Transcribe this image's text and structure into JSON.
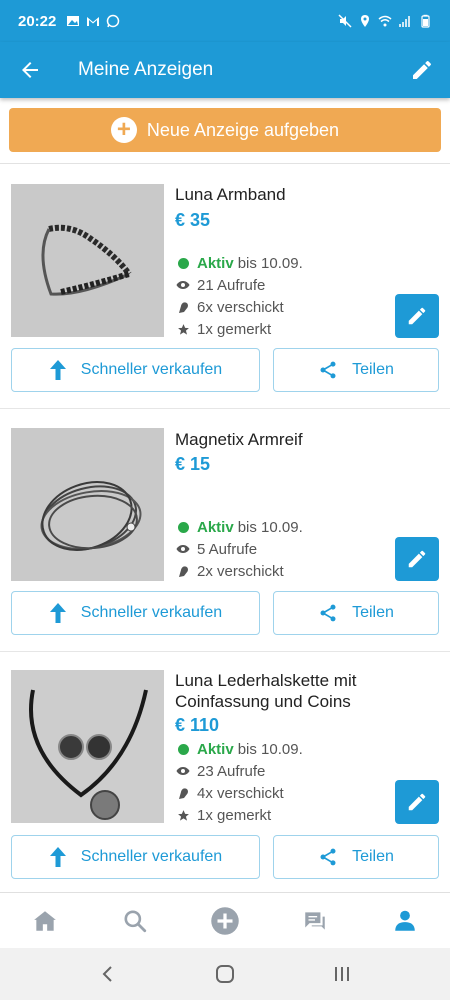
{
  "statusbar": {
    "time": "20:22"
  },
  "appbar": {
    "title": "Meine Anzeigen"
  },
  "new_ad": {
    "label": "Neue Anzeige aufgeben"
  },
  "listings": [
    {
      "title": "Luna Armband",
      "price": "€ 35",
      "status": "Aktiv",
      "until": "bis 10.09.",
      "views": "21 Aufrufe",
      "sent": "6x verschickt",
      "saved": "1x gemerkt",
      "sell_faster": "Schneller verkaufen",
      "share": "Teilen"
    },
    {
      "title": "Magnetix Armreif",
      "price": "€ 15",
      "status": "Aktiv",
      "until": "bis 10.09.",
      "views": "5 Aufrufe",
      "sent": "2x verschickt",
      "sell_faster": "Schneller verkaufen",
      "share": "Teilen"
    },
    {
      "title": "Luna Lederhalskette mit Coinfassung und Coins",
      "price": "€ 110",
      "status": "Aktiv",
      "until": "bis 10.09.",
      "views": "23 Aufrufe",
      "sent": "4x verschickt",
      "saved": "1x gemerkt",
      "sell_faster": "Schneller verkaufen",
      "share": "Teilen"
    }
  ],
  "bottom_nav": [
    "home-icon",
    "search-icon",
    "add-icon",
    "messages-icon",
    "profile-icon"
  ],
  "colors": {
    "primary": "#1e9ad6",
    "accent": "#f0a953",
    "active": "#2aa84a"
  }
}
